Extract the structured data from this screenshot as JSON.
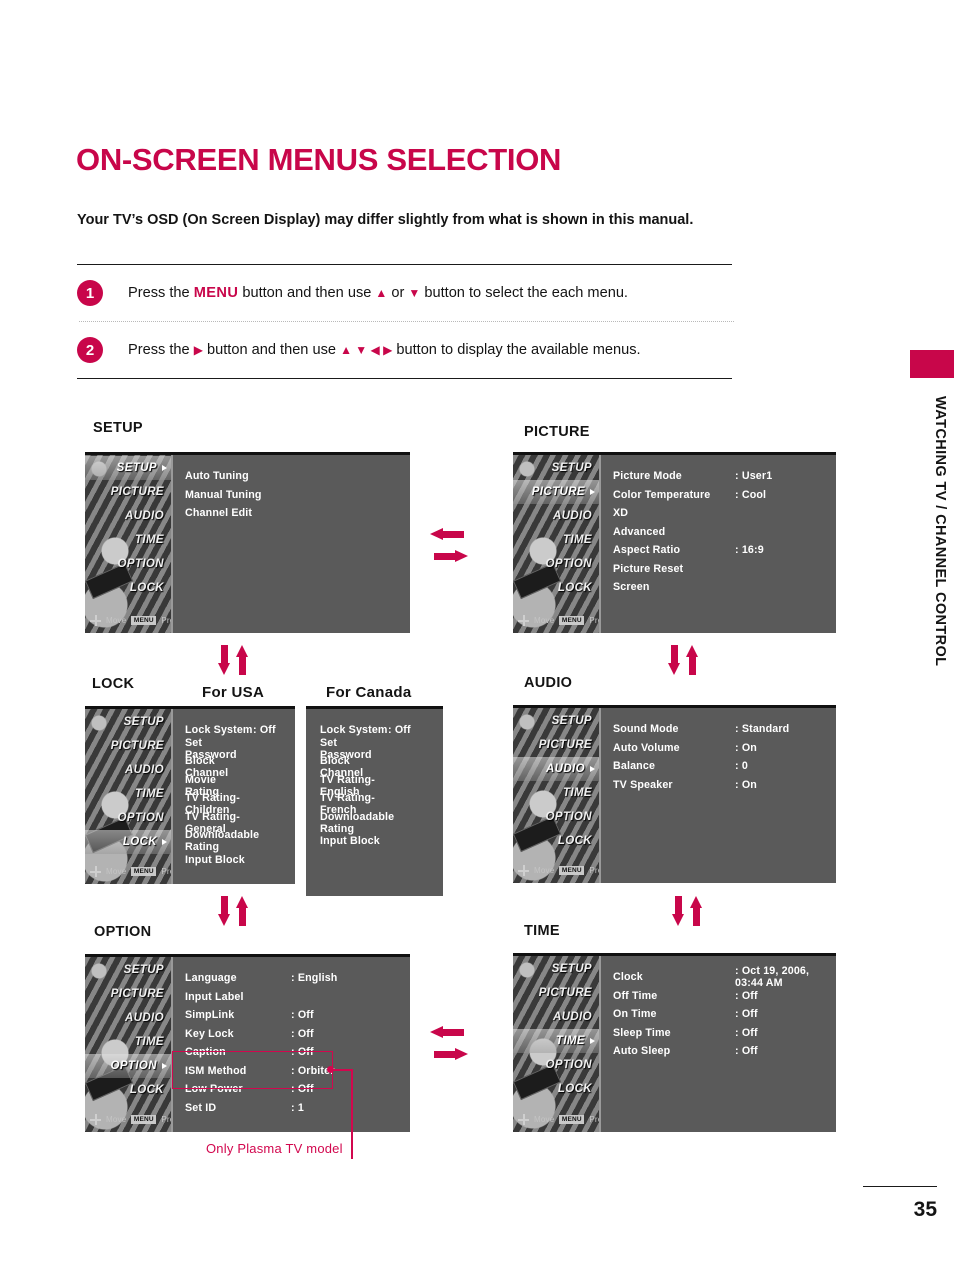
{
  "page": {
    "title": "ON-SCREEN MENUS SELECTION",
    "intro": "Your TV’s OSD (On Screen Display) may differ slightly from what is shown in this manual.",
    "section_vertical": "WATCHING TV / CHANNEL CONTROL",
    "page_number": "35",
    "accent_color": "#c8064a"
  },
  "steps": [
    {
      "badge": "1",
      "pre": "Press the ",
      "keyword": "MENU",
      "mid": " button and then use ",
      "glyphs_a": "▲",
      "conj": " or ",
      "glyphs_b": "▼",
      "post": " button to select the each menu."
    },
    {
      "badge": "2",
      "pre": "Press the ",
      "keyword": "▶",
      "mid": " button and then use ",
      "glyphs_a": "▲ ▼ ◀ ▶",
      "conj": "",
      "glyphs_b": "",
      "post": " button to display the available menus."
    }
  ],
  "osd_common": {
    "sidebar_items": [
      "SETUP",
      "PICTURE",
      "AUDIO",
      "TIME",
      "OPTION",
      "LOCK"
    ],
    "footer_move": "Move",
    "footer_menu_badge": "MENU",
    "footer_prev": "Prev"
  },
  "panels": {
    "setup": {
      "label": "SETUP",
      "selected": "SETUP",
      "rows": [
        {
          "label": "Auto Tuning",
          "value": ""
        },
        {
          "label": "Manual Tuning",
          "value": ""
        },
        {
          "label": "Channel Edit",
          "value": ""
        }
      ]
    },
    "picture": {
      "label": "PICTURE",
      "selected": "PICTURE",
      "rows": [
        {
          "label": "Picture Mode",
          "value": ": User1"
        },
        {
          "label": "Color Temperature",
          "value": ": Cool"
        },
        {
          "label": "XD",
          "value": ""
        },
        {
          "label": "Advanced",
          "value": ""
        },
        {
          "label": "Aspect Ratio",
          "value": ": 16:9"
        },
        {
          "label": "Picture Reset",
          "value": ""
        },
        {
          "label": "Screen",
          "value": ""
        }
      ]
    },
    "lock": {
      "label": "LOCK",
      "selected": "LOCK",
      "usa_heading": "For USA",
      "canada_heading": "For Canada",
      "usa_rows": [
        {
          "label": "Lock System",
          "value": ": Off"
        },
        {
          "label": "Set Password",
          "value": ""
        },
        {
          "label": "Block Channel",
          "value": ""
        },
        {
          "label": "Movie Rating",
          "value": ""
        },
        {
          "label": "TV Rating-Children",
          "value": ""
        },
        {
          "label": "TV Rating-General",
          "value": ""
        },
        {
          "label": "Downloadable Rating",
          "value": ""
        },
        {
          "label": "Input Block",
          "value": ""
        }
      ],
      "canada_rows": [
        {
          "label": "Lock System",
          "value": ": Off"
        },
        {
          "label": "Set Password",
          "value": ""
        },
        {
          "label": "Block Channel",
          "value": ""
        },
        {
          "label": "TV Rating-English",
          "value": ""
        },
        {
          "label": "TV Rating-French",
          "value": ""
        },
        {
          "label": "Downloadable Rating",
          "value": ""
        },
        {
          "label": "Input Block",
          "value": ""
        }
      ]
    },
    "audio": {
      "label": "AUDIO",
      "selected": "AUDIO",
      "rows": [
        {
          "label": "Sound Mode",
          "value": ": Standard"
        },
        {
          "label": "Auto Volume",
          "value": ": On"
        },
        {
          "label": "Balance",
          "value": ": 0"
        },
        {
          "label": "TV Speaker",
          "value": ": On"
        }
      ]
    },
    "option": {
      "label": "OPTION",
      "selected": "OPTION",
      "rows": [
        {
          "label": "Language",
          "value": ": English"
        },
        {
          "label": "Input Label",
          "value": ""
        },
        {
          "label": "SimpLink",
          "value": ": Off"
        },
        {
          "label": "Key Lock",
          "value": ": Off"
        },
        {
          "label": "Caption",
          "value": ": Off"
        },
        {
          "label": "ISM Method",
          "value": ": Orbiter"
        },
        {
          "label": "Low Power",
          "value": ": Off"
        },
        {
          "label": "Set ID",
          "value": ": 1"
        }
      ],
      "callout": "Only Plasma TV model",
      "callout_color": "#d2074e"
    },
    "time": {
      "label": "TIME",
      "selected": "TIME",
      "rows": [
        {
          "label": "Clock",
          "value": ": Oct 19, 2006, 03:44 AM"
        },
        {
          "label": "Off Time",
          "value": ": Off"
        },
        {
          "label": "On Time",
          "value": ": Off"
        },
        {
          "label": "Sleep Time",
          "value": ": Off"
        },
        {
          "label": "Auto Sleep",
          "value": ": Off"
        }
      ]
    }
  }
}
